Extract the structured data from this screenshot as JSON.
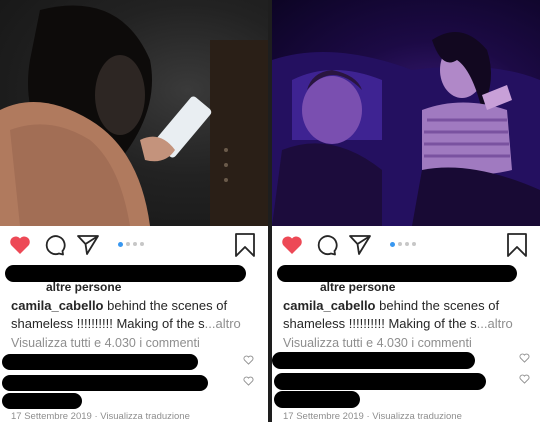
{
  "left_post": {
    "likes_suffix": "altre persone",
    "caption_username": "camila_cabello",
    "caption_text_line1": " behind the scenes of",
    "caption_text_line2": "shameless !!!!!!!!!! Making of the s",
    "caption_more": "...altro",
    "view_comments": "Visualizza tutti e 4.030 i commenti",
    "date": "17 Settembre 2019 · Visualizza traduzione",
    "liked": true,
    "carousel_dots": 4,
    "active_dot": 0
  },
  "right_post": {
    "likes_suffix": "altre persone",
    "caption_username": "camila_cabello",
    "caption_text_line1": " behind the scenes of",
    "caption_text_line2": "shameless !!!!!!!!!! Making of the s",
    "caption_more": "...altro",
    "view_comments": "Visualizza tutti e 4.030 i commenti",
    "date": "17 Settembre 2019 · Visualizza traduzione",
    "liked": true,
    "carousel_dots": 4,
    "active_dot": 0
  },
  "colors": {
    "liked_heart": "#ed4956",
    "active_dot": "#3897f0",
    "secondary_text": "#8e8e8e",
    "primary_text": "#262626"
  }
}
